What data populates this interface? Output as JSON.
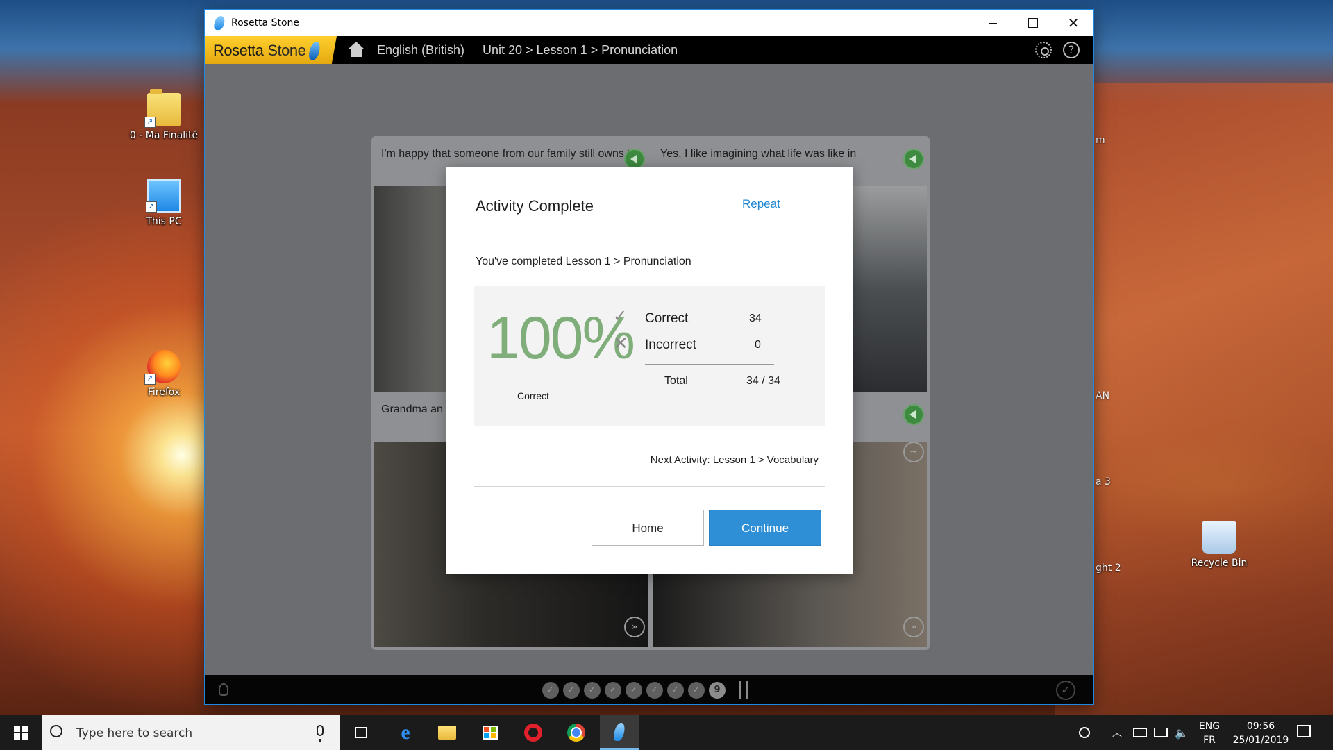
{
  "window": {
    "title": "Rosetta Stone"
  },
  "toolbar": {
    "logo_text_a": "Rosetta",
    "logo_text_b": "Stone",
    "language": "English (British)",
    "path": "Unit 20 > Lesson 1 > Pronunciation"
  },
  "cards": [
    {
      "caption": "I'm happy that someone from our family still owns th"
    },
    {
      "caption": "Yes, I like imagining what life was like in"
    },
    {
      "caption": "Grandma an then..."
    },
    {
      "caption": ""
    }
  ],
  "progress": {
    "dots": [
      "✓",
      "✓",
      "✓",
      "✓",
      "✓",
      "✓",
      "✓",
      "✓",
      "9"
    ]
  },
  "modal": {
    "title": "Activity Complete",
    "repeat_label": "Repeat",
    "completed_text": "You've completed Lesson 1 > Pronunciation",
    "score_percent": "100%",
    "score_caption": "Correct",
    "correct_label": "Correct",
    "correct_value": "34",
    "incorrect_label": "Incorrect",
    "incorrect_value": "0",
    "total_label": "Total",
    "total_value": "34 / 34",
    "next_activity": "Next Activity: Lesson 1 > Vocabulary",
    "home_label": "Home",
    "continue_label": "Continue"
  },
  "desktop": {
    "icons": [
      {
        "label": "0 - Ma Finalité",
        "icon": "folder-icon"
      },
      {
        "label": "This PC",
        "icon": "computer-icon"
      },
      {
        "label": "Firefox",
        "icon": "firefox-icon"
      },
      {
        "label": "Recycle Bin",
        "icon": "recycle-bin-icon"
      }
    ],
    "peek_labels": [
      "m",
      "AN",
      "a 3",
      "ght 2"
    ]
  },
  "taskbar": {
    "search_placeholder": "Type here to search",
    "lang_line1": "ENG",
    "lang_line2": "FR",
    "time": "09:56",
    "date": "25/01/2019"
  },
  "colors": {
    "accent": "#2f8fd6",
    "score_green": "#7fae7b",
    "logo_yellow": "#ffcf2e"
  }
}
